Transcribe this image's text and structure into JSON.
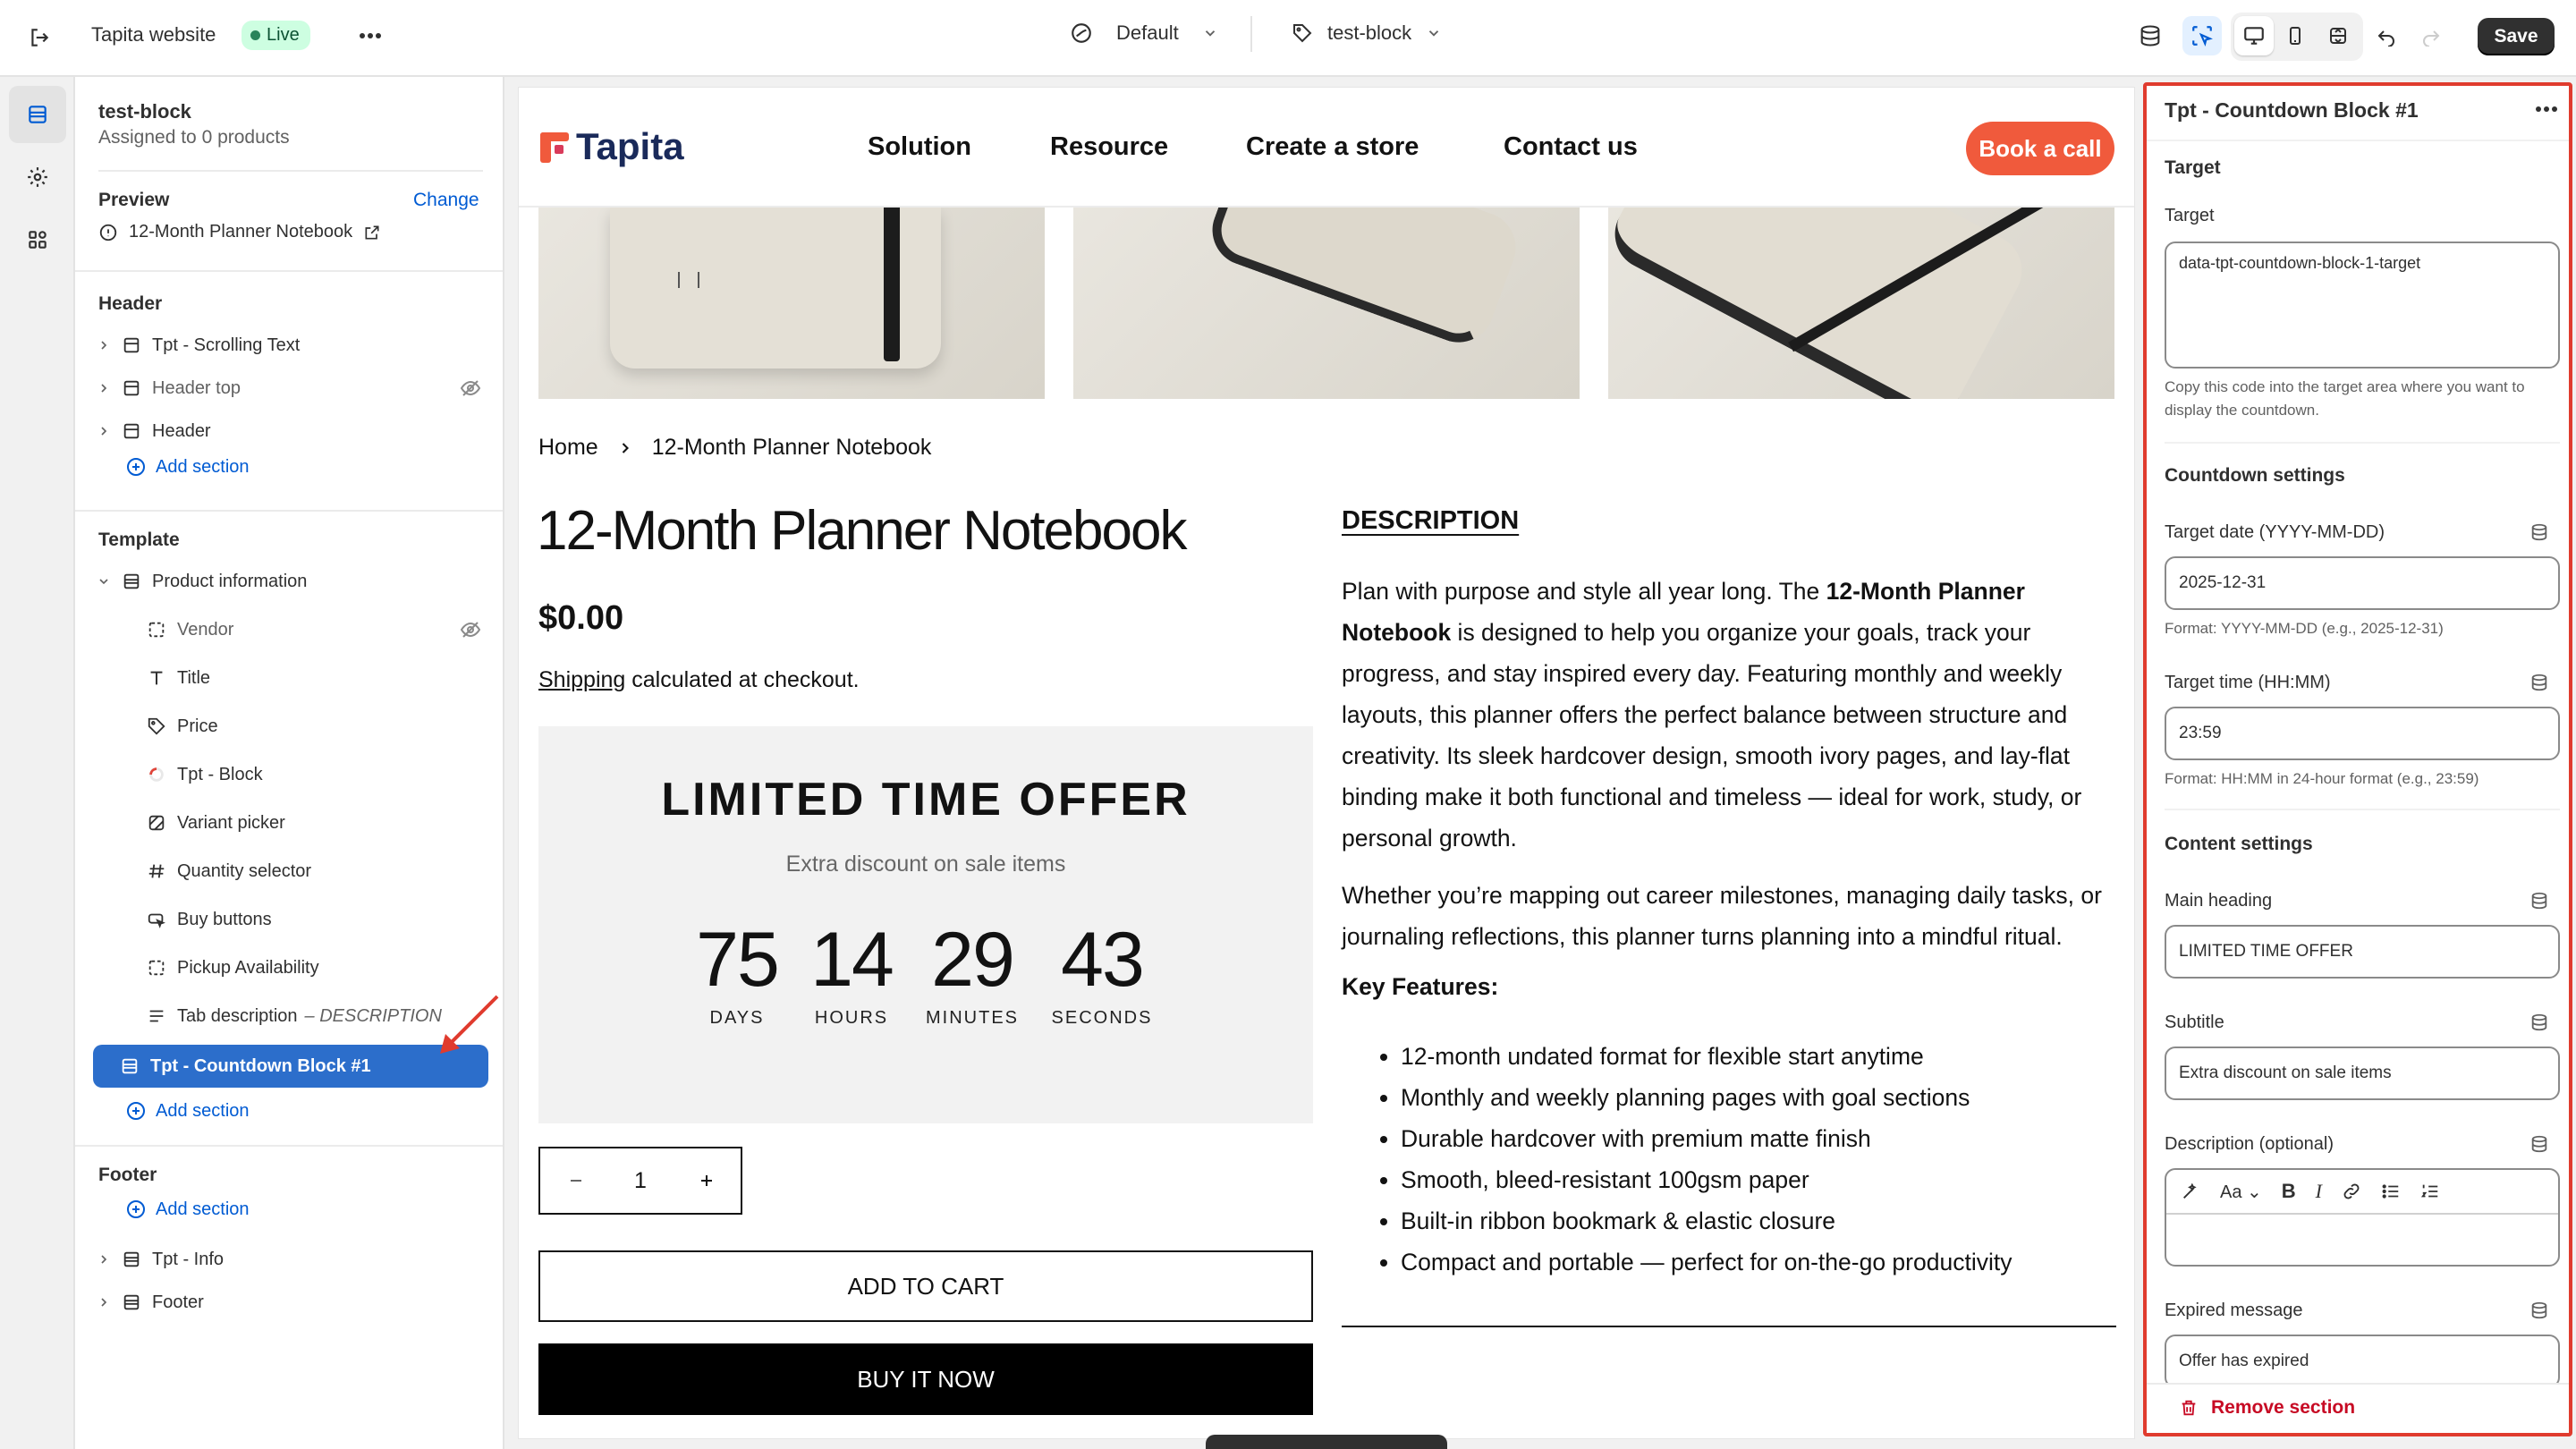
{
  "topbar": {
    "site_name": "Tapita website",
    "live_badge": "Live",
    "theme_label": "Default",
    "template_label": "test-block",
    "save_label": "Save"
  },
  "left_panel": {
    "title": "test-block",
    "subtitle": "Assigned to 0 products",
    "preview_label": "Preview",
    "change_label": "Change",
    "preview_product": "12-Month Planner Notebook",
    "header_group": {
      "heading": "Header",
      "items": [
        "Tpt - Scrolling Text",
        "Header top",
        "Header"
      ],
      "add_section": "Add section"
    },
    "template_group": {
      "heading": "Template",
      "section": "Product information",
      "blocks": [
        "Vendor",
        "Title",
        "Price",
        "Tpt - Block",
        "Variant picker",
        "Quantity selector",
        "Buy buttons",
        "Pickup Availability",
        "Tab description"
      ],
      "tab_description_suffix": "– DESCRIPTION",
      "selected_block": "Tpt - Countdown Block #1",
      "add_section": "Add section"
    },
    "footer_group": {
      "heading": "Footer",
      "add_section": "Add section",
      "items": [
        "Tpt - Info",
        "Footer"
      ]
    }
  },
  "store": {
    "logo_text": "Tapita",
    "nav": [
      "Solution",
      "Resource",
      "Create a store",
      "Contact us"
    ],
    "cta": "Book a call",
    "breadcrumb": [
      "Home",
      "12-Month Planner Notebook"
    ],
    "product_title": "12-Month Planner Notebook",
    "price": "$0.00",
    "shipping_link": "Shipping",
    "shipping_rest": " calculated at checkout.",
    "countdown": {
      "heading": "LIMITED TIME OFFER",
      "subtitle": "Extra discount on sale items",
      "units": [
        {
          "value": "75",
          "label": "DAYS"
        },
        {
          "value": "14",
          "label": "HOURS"
        },
        {
          "value": "29",
          "label": "MINUTES"
        },
        {
          "value": "43",
          "label": "SECONDS"
        }
      ]
    },
    "quantity": "1",
    "add_to_cart": "ADD TO CART",
    "buy_now": "BUY IT NOW",
    "description": {
      "heading": "DESCRIPTION",
      "p1_a": "Plan with purpose and style all year long. The ",
      "p1_bold": "12-Month Planner Notebook",
      "p1_b": " is designed to help you organize your goals, track your progress, and stay inspired every day. Featuring monthly and weekly layouts, this planner offers the perfect balance between structure and creativity. Its sleek hardcover design, smooth ivory pages, and lay-flat binding make it both functional and timeless — ideal for work, study, or personal growth.",
      "p2": "Whether you’re mapping out career milestones, managing daily tasks, or journaling reflections, this planner turns planning into a mindful ritual.",
      "features_heading": "Key Features:",
      "features": [
        "12-month undated format for flexible start anytime",
        "Monthly and weekly planning pages with goal sections",
        "Durable hardcover with premium matte finish",
        "Smooth, bleed-resistant 100gsm paper",
        "Built-in ribbon bookmark & elastic closure",
        "Compact and portable — perfect for on-the-go productivity"
      ]
    }
  },
  "right_panel": {
    "title": "Tpt - Countdown Block #1",
    "target_heading": "Target",
    "target_label": "Target",
    "target_value": "data-tpt-countdown-block-1-target",
    "target_help": "Copy this code into the target area where you want to display the countdown.",
    "countdown_heading": "Countdown settings",
    "date_label": "Target date (YYYY-MM-DD)",
    "date_value": "2025-12-31",
    "date_help": "Format: YYYY-MM-DD (e.g., 2025-12-31)",
    "time_label": "Target time (HH:MM)",
    "time_value": "23:59",
    "time_help": "Format: HH:MM in 24-hour format (e.g., 23:59)",
    "content_heading": "Content settings",
    "main_heading_label": "Main heading",
    "main_heading_value": "LIMITED TIME OFFER",
    "subtitle_label": "Subtitle",
    "subtitle_value": "Extra discount on sale items",
    "description_label": "Description (optional)",
    "expired_label": "Expired message",
    "expired_value": "Offer has expired",
    "remove_label": "Remove section"
  },
  "colors": {
    "selected": "#2c6ecb",
    "cta": "#f05a3c",
    "highlight_border": "#e03b2e",
    "link": "#005bd3"
  }
}
